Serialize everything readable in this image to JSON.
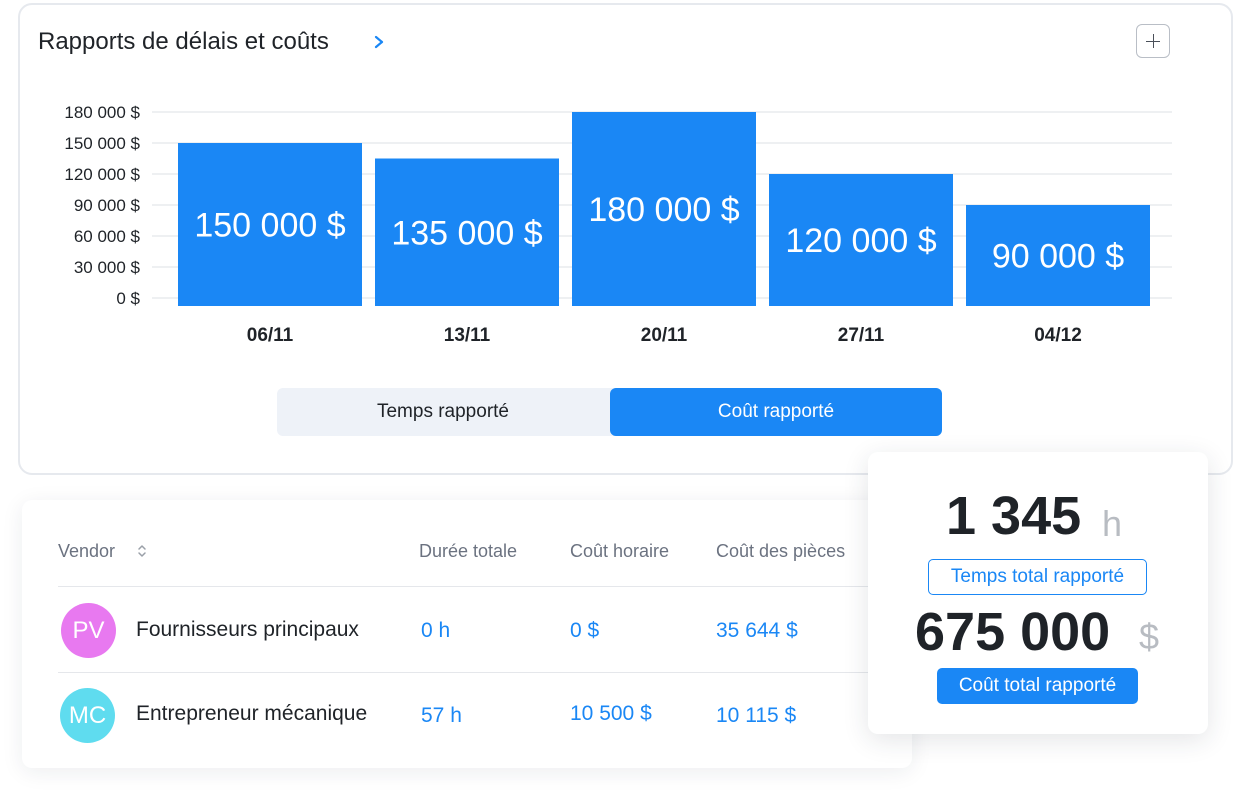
{
  "report": {
    "title": "Rapports de délais et coûts"
  },
  "chart_data": {
    "type": "bar",
    "categories": [
      "06/11",
      "13/11",
      "20/11",
      "27/11",
      "04/12"
    ],
    "values": [
      150000,
      135000,
      180000,
      120000,
      90000
    ],
    "value_labels": [
      "150 000 $",
      "135 000 $",
      "180 000 $",
      "120 000 $",
      "90 000 $"
    ],
    "y_ticks": [
      0,
      30000,
      60000,
      90000,
      120000,
      150000,
      180000
    ],
    "y_tick_labels": [
      "0 $",
      "30 000 $",
      "60 000 $",
      "90 000 $",
      "120 000 $",
      "150 000 $",
      "180 000 $"
    ],
    "ylim": [
      0,
      180000
    ],
    "grid": true,
    "bar_color": "#1a87f5"
  },
  "toggle": {
    "options": [
      "Temps rapporté",
      "Coût rapporté"
    ],
    "selected": "Coût rapporté"
  },
  "table": {
    "columns": [
      "Vendor",
      "Durée totale",
      "Coût horaire",
      "Coût des pièces"
    ],
    "rows": [
      {
        "initials": "PV",
        "avatar_color": "#e879f0",
        "name": "Fournisseurs principaux",
        "duration": "0 h",
        "hourly": "0 $",
        "parts": "35 644 $"
      },
      {
        "initials": "MC",
        "avatar_color": "#5fdcef",
        "name": "Entrepreneur mécanique",
        "duration": "57 h",
        "hourly": "10 500 $",
        "parts": "10 115 $"
      }
    ]
  },
  "summary": {
    "total_time": "1 345",
    "total_time_unit": "h",
    "total_time_label": "Temps total rapporté",
    "total_cost": "675 000",
    "total_cost_unit": "$",
    "total_cost_label": "Coût total rapporté"
  },
  "colors": {
    "accent": "#1a87f5",
    "text": "#1f2328",
    "muted": "#6b7280"
  }
}
